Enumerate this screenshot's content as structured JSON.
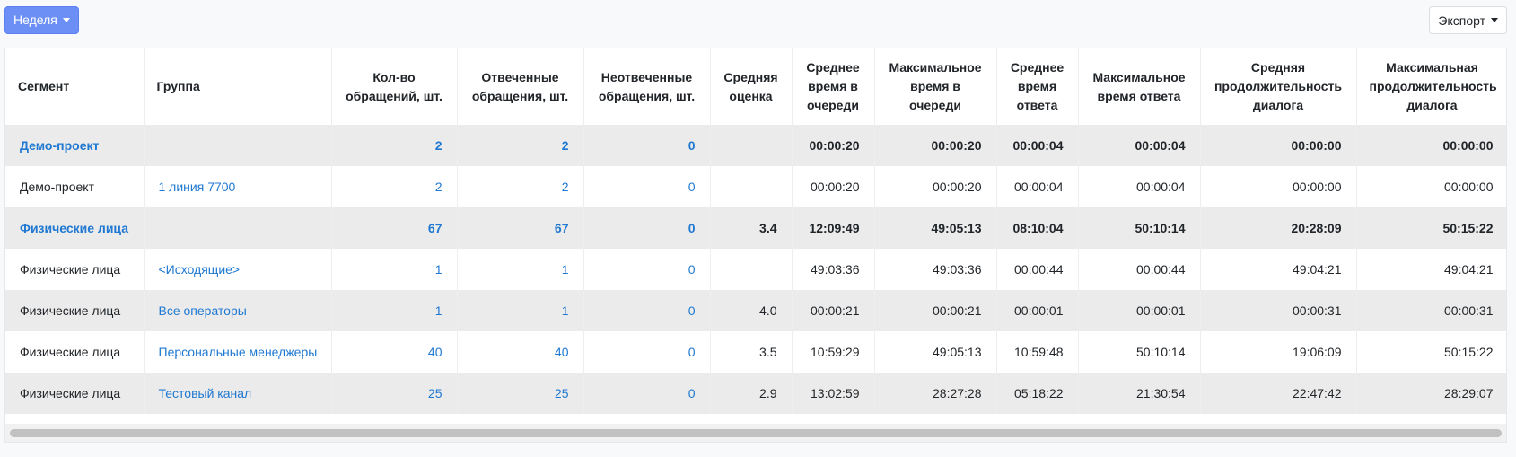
{
  "toolbar": {
    "period_label": "Неделя",
    "export_label": "Экспорт"
  },
  "table": {
    "headers": [
      "Сегмент",
      "Группа",
      "Кол-во обращений, шт.",
      "Отвеченные обращения, шт.",
      "Неотвеченные обращения, шт.",
      "Средняя оценка",
      "Среднее время в очереди",
      "Максимальное время в очереди",
      "Среднее время ответа",
      "Максимальное время ответа",
      "Средняя продолжительность диалога",
      "Максимальная продолжительность диалога"
    ],
    "rows": [
      {
        "segment": "Демо-проект",
        "group": "",
        "total": "2",
        "answered": "2",
        "unanswered": "0",
        "rating": "",
        "avg_queue": "00:00:20",
        "max_queue": "00:00:20",
        "avg_answer": "00:00:04",
        "max_answer": "00:00:04",
        "avg_dialog": "00:00:00",
        "max_dialog": "00:00:00"
      },
      {
        "segment": "Демо-проект",
        "group": "1 линия 7700",
        "total": "2",
        "answered": "2",
        "unanswered": "0",
        "rating": "",
        "avg_queue": "00:00:20",
        "max_queue": "00:00:20",
        "avg_answer": "00:00:04",
        "max_answer": "00:00:04",
        "avg_dialog": "00:00:00",
        "max_dialog": "00:00:00"
      },
      {
        "segment": "Физические лица",
        "group": "",
        "total": "67",
        "answered": "67",
        "unanswered": "0",
        "rating": "3.4",
        "avg_queue": "12:09:49",
        "max_queue": "49:05:13",
        "avg_answer": "08:10:04",
        "max_answer": "50:10:14",
        "avg_dialog": "20:28:09",
        "max_dialog": "50:15:22"
      },
      {
        "segment": "Физические лица",
        "group": "<Исходящие>",
        "total": "1",
        "answered": "1",
        "unanswered": "0",
        "rating": "",
        "avg_queue": "49:03:36",
        "max_queue": "49:03:36",
        "avg_answer": "00:00:44",
        "max_answer": "00:00:44",
        "avg_dialog": "49:04:21",
        "max_dialog": "49:04:21"
      },
      {
        "segment": "Физические лица",
        "group": "Все операторы",
        "total": "1",
        "answered": "1",
        "unanswered": "0",
        "rating": "4.0",
        "avg_queue": "00:00:21",
        "max_queue": "00:00:21",
        "avg_answer": "00:00:01",
        "max_answer": "00:00:01",
        "avg_dialog": "00:00:31",
        "max_dialog": "00:00:31"
      },
      {
        "segment": "Физические лица",
        "group": "Персональные менеджеры",
        "total": "40",
        "answered": "40",
        "unanswered": "0",
        "rating": "3.5",
        "avg_queue": "10:59:29",
        "max_queue": "49:05:13",
        "avg_answer": "10:59:48",
        "max_answer": "50:10:14",
        "avg_dialog": "19:06:09",
        "max_dialog": "50:15:22"
      },
      {
        "segment": "Физические лица",
        "group": "Тестовый канал",
        "total": "25",
        "answered": "25",
        "unanswered": "0",
        "rating": "2.9",
        "avg_queue": "13:02:59",
        "max_queue": "28:27:28",
        "avg_answer": "05:18:22",
        "max_answer": "21:30:54",
        "avg_dialog": "22:47:42",
        "max_dialog": "28:29:07"
      }
    ]
  },
  "colors": {
    "accent": "#6c8ff6",
    "link": "#1f78d1",
    "row_shade": "#ebebeb"
  }
}
